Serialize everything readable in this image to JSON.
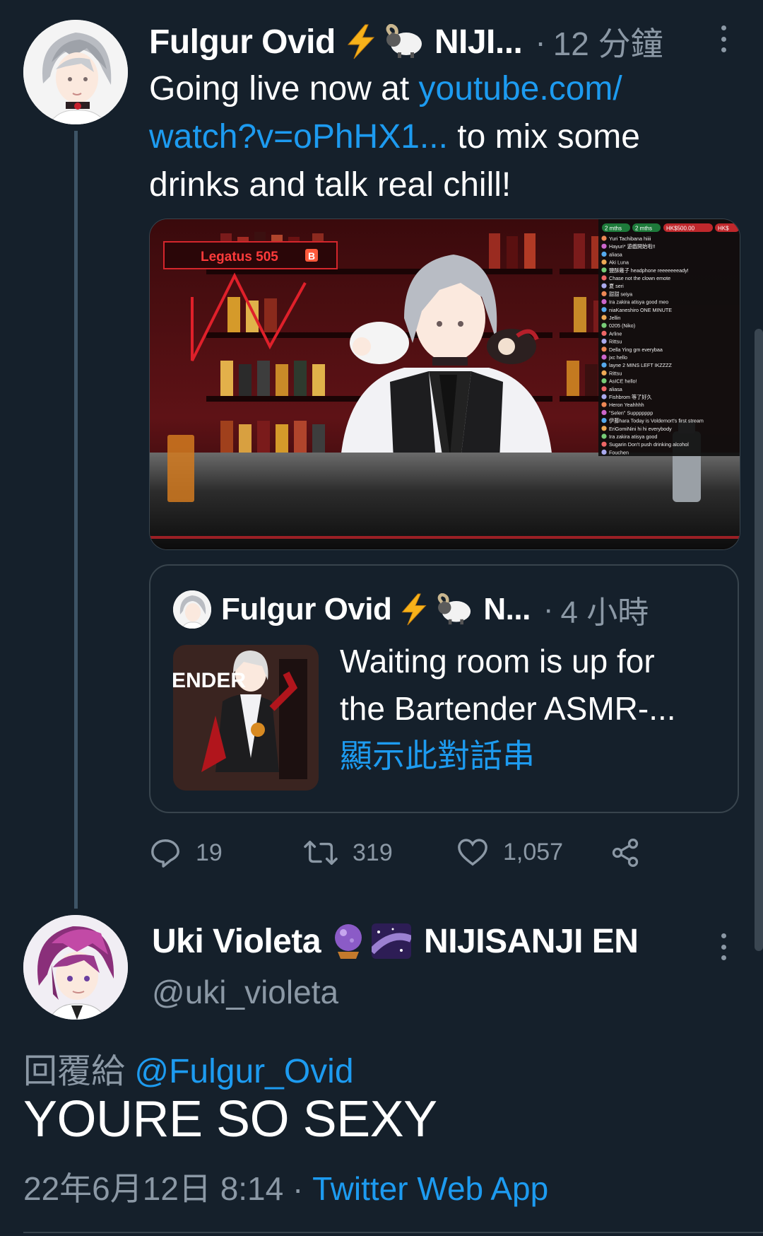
{
  "tweet1": {
    "display_name": "Fulgur Ovid",
    "name_suffix": "NIJI...",
    "emoji1": "lightning-emoji",
    "emoji2": "ram-emoji",
    "separator": "·",
    "time": "12 分鐘",
    "text_before_link": "Going live now at ",
    "link_line1": "youtube.com/",
    "link_line2": "watch?v=oPhHX1...",
    "text_after_link": " to mix some",
    "text_line3": "drinks and talk real chill!",
    "stream_image": {
      "banner_text": "Legatus 505",
      "banner_badge": "B",
      "chat_stats": [
        "2 mths",
        "2 mths",
        "HK$500.00",
        "HK$"
      ],
      "chat_lines": [
        "Yuri Tachibana hiiii",
        "Hayuri* 遊戲開始啦!!",
        "aliasa",
        "Aki Luna",
        "鹽酥雞子 headphone reeeeeeeady!",
        "Chase not the clown emote",
        "夏 seri",
        "甜甜 seiya",
        "Ira zakira atisya good meo",
        "niaKaneshiro ONE MINUTE",
        "Jellin",
        "0205 (Niko)",
        "Arline",
        "Rittsu",
        "Della Ying gm everybaa",
        "jxc hello",
        "layne 2 MINS LEFT IKZZZZ",
        "Rittsu",
        "AsICE hello!",
        "aliasa",
        "Fishbrom 等了好久",
        "Heron Yeahhhh",
        "\"Selen\" Suppppppp",
        "伊藤hara Today is Voldemort's first stream",
        "EriGomiNini hi hi everybody",
        "Ira zakira atisya good",
        "Sugarin Don't push drinking alcohol",
        "Fouchen"
      ]
    }
  },
  "quote": {
    "display_name": "Fulgur Ovid",
    "name_suffix": "N...",
    "separator": "·",
    "time": "4 小時",
    "text_line1": "Waiting room is up for",
    "text_line2": "the Bartender ASMR-...",
    "show_thread": "顯示此對話串",
    "thumb_text": "ENDER"
  },
  "actions": {
    "reply_count": "19",
    "retweet_count": "319",
    "like_count": "1,057",
    "reply_icon": "reply-icon",
    "retweet_icon": "retweet-icon",
    "like_icon": "heart-icon",
    "share_icon": "share-icon"
  },
  "tweet2": {
    "display_name": "Uki Violeta",
    "emoji1": "crystal-ball-emoji",
    "emoji2": "milky-way-emoji",
    "name_suffix": "NIJISANJI EN",
    "handle": "@uki_violeta",
    "reply_prefix": "回覆給 ",
    "reply_handle": "@Fulgur_Ovid",
    "text": "YOURE SO SEXY",
    "timestamp": "22年6月12日 8:14",
    "separator": " · ",
    "source": "Twitter Web App"
  },
  "colors": {
    "background": "#15202b",
    "accent": "#1d9bf0",
    "secondary_text": "#8b98a5",
    "border": "#38444d"
  }
}
